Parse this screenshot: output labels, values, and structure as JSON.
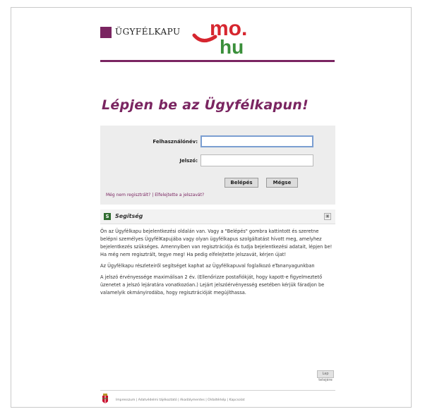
{
  "header": {
    "logo_text": "ÜGYFÉLKAPU",
    "brand_mo": "mo.",
    "brand_hu": "hu",
    "accent": "#7a2561",
    "brand_red": "#d6262f",
    "brand_green": "#3a8f3a"
  },
  "title": "Lépjen be az Ügyfélkapun!",
  "login": {
    "username_label": "Felhasználónév:",
    "password_label": "Jelszó:",
    "username_value": "",
    "password_value": "",
    "login_button": "Belépés",
    "cancel_button": "Mégse",
    "register_link": "Még nem regisztrált?",
    "separator": "|",
    "forgot_link": "Elfelejtette a jelszavát?"
  },
  "help": {
    "icon": "S",
    "title": "Segítség",
    "close": "▣",
    "paragraphs": [
      "Ön az Ügyfélkapu bejelentkezési oldalán van. Vagy a \"Belépés\" gombra kattintott és szeretne belépni személyes ÜgyfélKapujába vagy olyan ügyfélkapus szolgáltatást hívott meg, amelyhez bejelentkezés szükséges. Amennyiben van regisztrációja és tudja bejelentkezési adatait, lépjen be! Ha még nem regisztrált, tegye meg! Ha pedig elfelejtette jelszavát, kérjen újat!",
      "Az Ügyfélkapu részleteiről segítséget kaphat az Ügyfélkapuval foglalkozó eTananyagunkban",
      "A jelszó érvényessége maximálisan 2 év. (Ellenőrizze postafiókját, hogy kapott-e figyelmeztető üzenetet a jelszó lejáratára vonatkozóan.) Lejárt jelszóérvényesség esetében kérjük fáradjon be valamelyik okmányirodába, hogy regisztrációját megújíthassa."
    ],
    "to_top": "Lap tetejére"
  },
  "footer": {
    "links": "Impresszum | Adatvédelmi tájékoztató | Akadálymentes | Oldaltérkép | Kapcsolat"
  }
}
